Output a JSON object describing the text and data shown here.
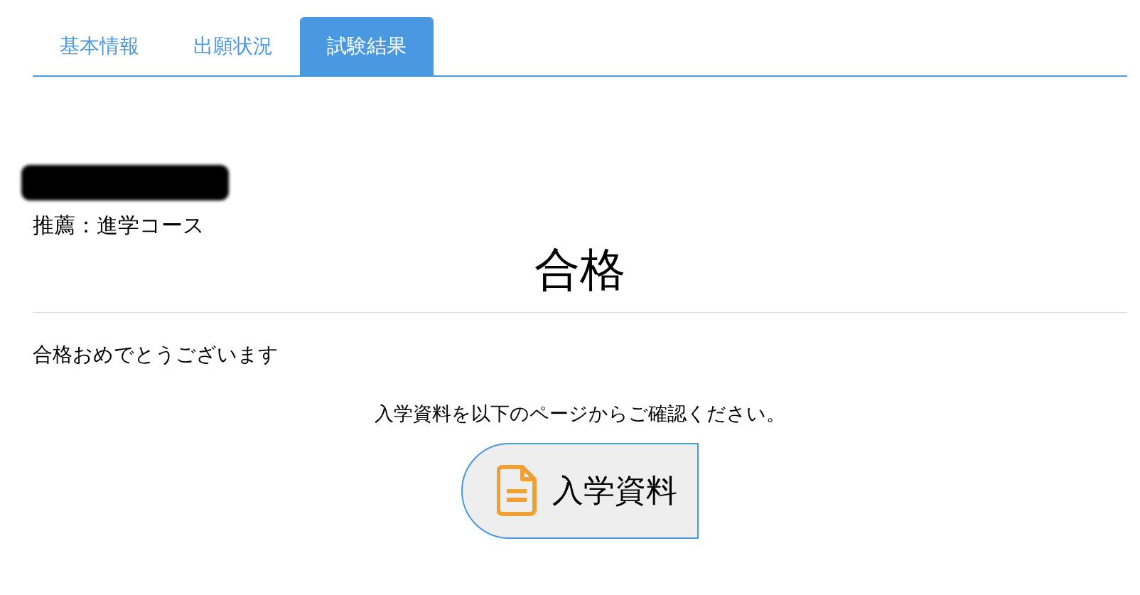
{
  "tabs": [
    {
      "label": "基本情報",
      "selected": false
    },
    {
      "label": "出願状況",
      "selected": false
    },
    {
      "label": "試験結果",
      "selected": true
    }
  ],
  "result": {
    "course": "推薦：進学コース",
    "verdict": "合格"
  },
  "message": "合格おめでとうございます",
  "instruction": "入学資料を以下のページからご確認ください。",
  "button": {
    "label": "入学資料"
  }
}
